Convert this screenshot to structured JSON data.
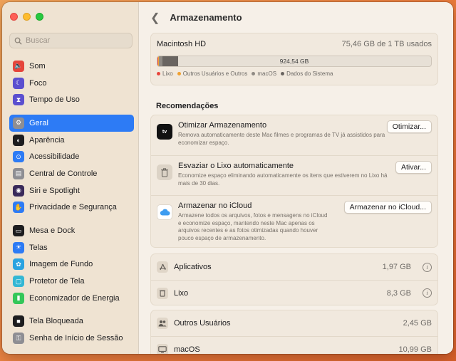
{
  "sidebar": {
    "search_placeholder": "Buscar",
    "groups": [
      [
        {
          "label": "Som",
          "icon": "speaker-icon",
          "color": "#e5443a"
        },
        {
          "label": "Foco",
          "icon": "moon-icon",
          "color": "#5b4fcf"
        },
        {
          "label": "Tempo de Uso",
          "icon": "hourglass-icon",
          "color": "#5b4fcf"
        }
      ],
      [
        {
          "label": "Geral",
          "icon": "gear-icon",
          "color": "#8e8e93",
          "active": true
        },
        {
          "label": "Aparência",
          "icon": "appearance-icon",
          "color": "#1d1d1f"
        },
        {
          "label": "Acessibilidade",
          "icon": "accessibility-icon",
          "color": "#2d7bf5"
        },
        {
          "label": "Central de Controle",
          "icon": "control-center-icon",
          "color": "#8e8e93"
        },
        {
          "label": "Siri e Spotlight",
          "icon": "siri-icon",
          "color": "#3a2a5a"
        },
        {
          "label": "Privacidade e Segurança",
          "icon": "hand-icon",
          "color": "#2d7bf5"
        }
      ],
      [
        {
          "label": "Mesa e Dock",
          "icon": "dock-icon",
          "color": "#1d1d1f"
        },
        {
          "label": "Telas",
          "icon": "sun-icon",
          "color": "#2d7bf5"
        },
        {
          "label": "Imagem de Fundo",
          "icon": "flower-icon",
          "color": "#2aa3e0"
        },
        {
          "label": "Protetor de Tela",
          "icon": "screensaver-icon",
          "color": "#33b7d4"
        },
        {
          "label": "Economizador de Energia",
          "icon": "battery-icon",
          "color": "#34c759"
        }
      ],
      [
        {
          "label": "Tela Bloqueada",
          "icon": "lock-icon",
          "color": "#1d1d1f"
        },
        {
          "label": "Senha de Início de Sessão",
          "icon": "key-icon",
          "color": "#8e8e93"
        }
      ]
    ]
  },
  "header": {
    "title": "Armazenamento"
  },
  "disk": {
    "name": "Macintosh HD",
    "used": "75,46 GB de 1 TB usados",
    "bar_label": "924,54 GB",
    "segments": [
      {
        "name": "Lixo",
        "color": "#e8453c",
        "fraction": 0.003
      },
      {
        "name": "Outros Usuários e Outros",
        "color": "#f0a030",
        "fraction": 0.003
      },
      {
        "name": "macOS",
        "color": "#8f8a84",
        "fraction": 0.011
      },
      {
        "name": "Dados do Sistema",
        "color": "#6a6561",
        "fraction": 0.058
      }
    ]
  },
  "recommendations": {
    "title": "Recomendações",
    "items": [
      {
        "title": "Otimizar Armazenamento",
        "desc": "Remova automaticamente deste Mac filmes e programas de TV já assistidos para economizar espaço.",
        "button": "Otimizar...",
        "icon": "apple-tv-icon"
      },
      {
        "title": "Esvaziar o Lixo automaticamente",
        "desc": "Economize espaço eliminando automaticamente os itens que estiverem no Lixo há mais de 30 dias.",
        "button": "Ativar...",
        "icon": "trash-icon"
      },
      {
        "title": "Armazenar no iCloud",
        "desc": "Armazene todos os arquivos, fotos e mensagens no iCloud e economize espaço, mantendo neste Mac apenas os arquivos recentes e as fotos otimizadas quando houver pouco espaço de armazenamento.",
        "button": "Armazenar no iCloud...",
        "icon": "icloud-icon"
      }
    ]
  },
  "categories": [
    {
      "label": "Aplicativos",
      "size": "1,97 GB",
      "icon": "apps-icon",
      "info": true
    },
    {
      "label": "Lixo",
      "size": "8,3 GB",
      "icon": "trash-icon",
      "info": true
    },
    {
      "label": "Outros Usuários",
      "size": "2,45 GB",
      "icon": "users-icon",
      "info": false
    },
    {
      "label": "macOS",
      "size": "10,99 GB",
      "icon": "macos-icon",
      "info": false
    }
  ]
}
